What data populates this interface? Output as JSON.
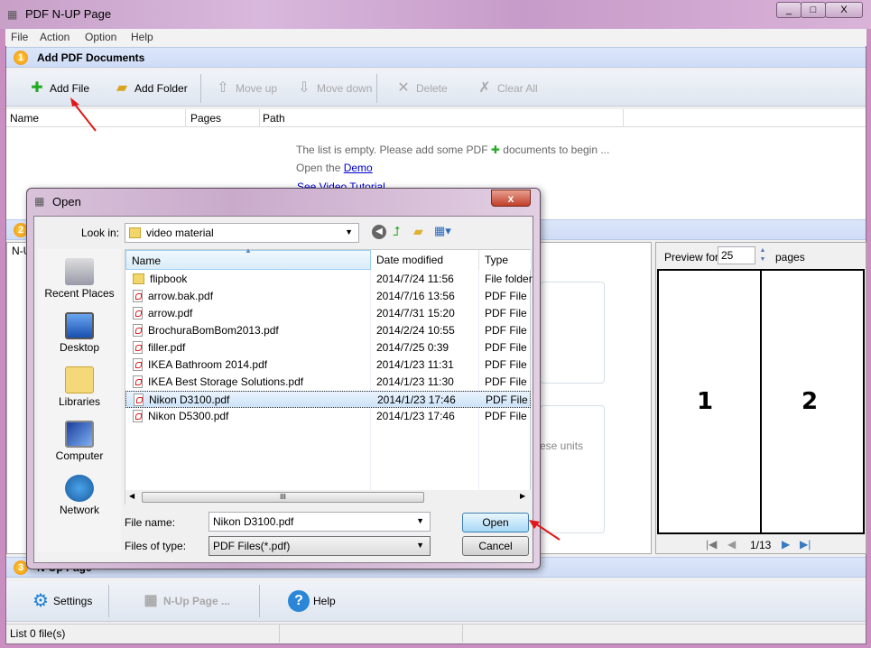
{
  "window": {
    "title": "PDF N-UP Page",
    "min": "_",
    "max": "□",
    "close": "X"
  },
  "menu": [
    "File",
    "Action",
    "Option",
    "Help"
  ],
  "section1": {
    "num": "1",
    "title": "Add PDF Documents"
  },
  "toolbar": {
    "add_file": "Add File",
    "add_folder": "Add Folder",
    "move_up": "Move up",
    "move_down": "Move down",
    "delete": "Delete",
    "clear_all": "Clear All"
  },
  "list": {
    "columns": [
      "Name",
      "Pages",
      "Path"
    ],
    "empty_msg_a": "The list is empty. Please add some PDF",
    "empty_msg_b": "documents to begin ...",
    "open_the": "Open the",
    "demo": "Demo",
    "video": "See Video Tutorial"
  },
  "section2": {
    "num": "2",
    "fragment": "N-U",
    "units_fragment": "ese units"
  },
  "preview": {
    "label": "Preview for",
    "value": "25",
    "suffix": "pages",
    "page_left": "1",
    "page_right": "2",
    "pager": "1/13"
  },
  "section3": {
    "num": "3",
    "title": "N-Up Page"
  },
  "bottom": {
    "settings": "Settings",
    "nup": "N-Up Page ...",
    "help": "Help"
  },
  "status": {
    "text": "List 0 file(s)"
  },
  "dialog": {
    "title": "Open",
    "close": "x",
    "look_in_label": "Look in:",
    "look_in": "video material",
    "places": [
      "Recent Places",
      "Desktop",
      "Libraries",
      "Computer",
      "Network"
    ],
    "columns": [
      "Name",
      "Date modified",
      "Type"
    ],
    "files": [
      {
        "name": "flipbook",
        "date": "2014/7/24 11:56",
        "type": "File folder",
        "folder": true
      },
      {
        "name": "arrow.bak.pdf",
        "date": "2014/7/16 13:56",
        "type": "PDF File"
      },
      {
        "name": "arrow.pdf",
        "date": "2014/7/31 15:20",
        "type": "PDF File"
      },
      {
        "name": "BrochuraBomBom2013.pdf",
        "date": "2014/2/24 10:55",
        "type": "PDF File"
      },
      {
        "name": "filler.pdf",
        "date": "2014/7/25 0:39",
        "type": "PDF File"
      },
      {
        "name": "IKEA Bathroom 2014.pdf",
        "date": "2014/1/23 11:31",
        "type": "PDF File"
      },
      {
        "name": "IKEA Best Storage Solutions.pdf",
        "date": "2014/1/23 11:30",
        "type": "PDF File"
      },
      {
        "name": "Nikon D3100.pdf",
        "date": "2014/1/23 17:46",
        "type": "PDF File",
        "selected": true
      },
      {
        "name": "Nikon D5300.pdf",
        "date": "2014/1/23 17:46",
        "type": "PDF File"
      }
    ],
    "file_name_label": "File name:",
    "file_name": "Nikon D3100.pdf",
    "file_type_label": "Files of type:",
    "file_type": "PDF Files(*.pdf)",
    "open": "Open",
    "cancel": "Cancel"
  }
}
